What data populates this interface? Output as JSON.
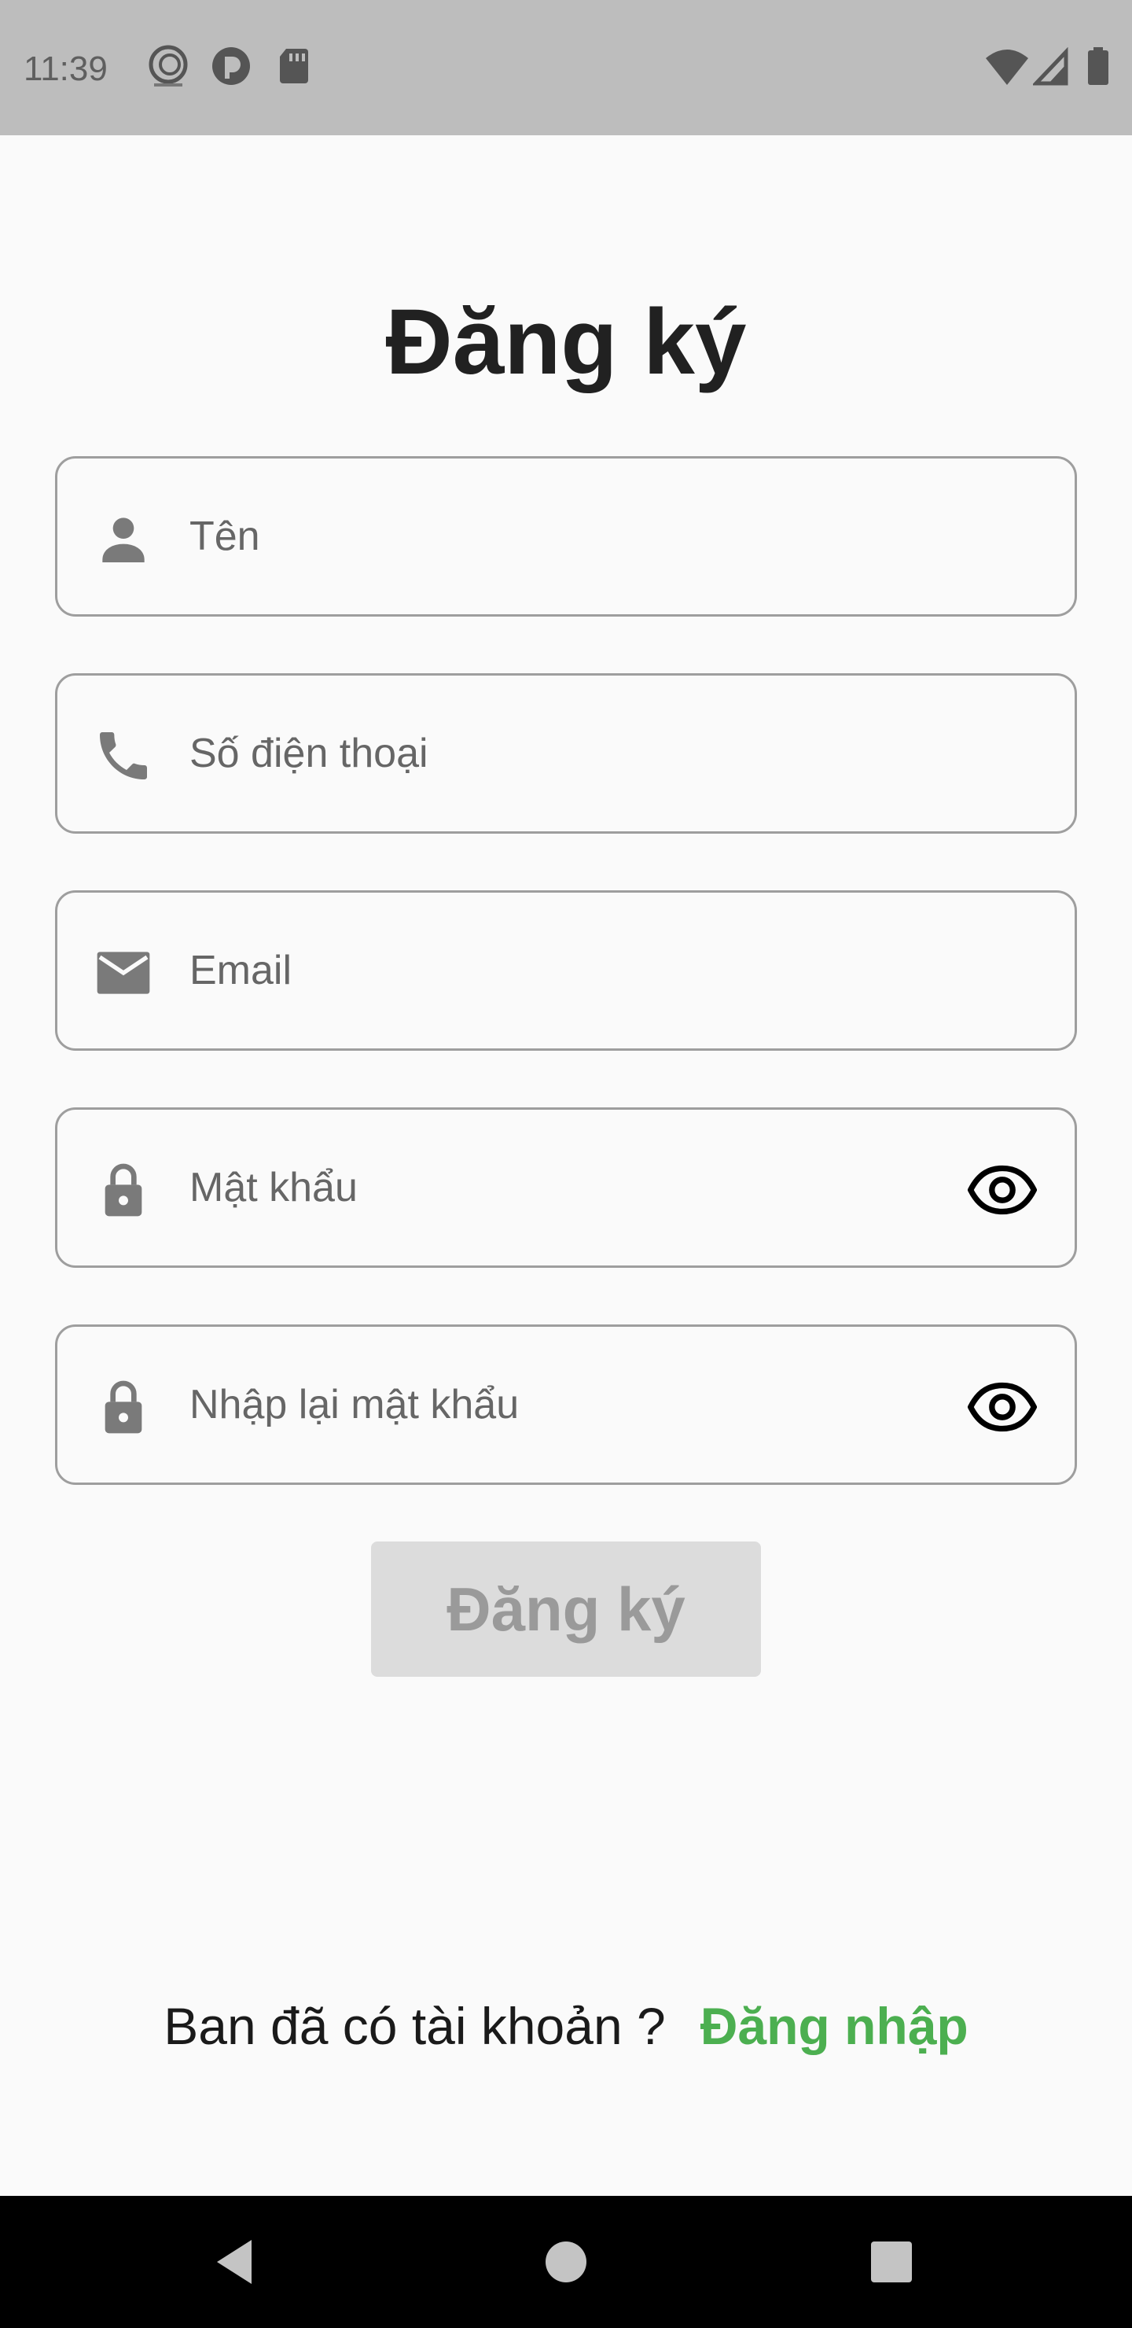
{
  "status_bar": {
    "time": "11:39",
    "left_icons": [
      "app-logo-icon",
      "pocket-icon",
      "sd-card-icon"
    ],
    "right_icons": [
      "wifi-icon",
      "signal-icon",
      "battery-icon"
    ]
  },
  "title": "Đăng ký",
  "fields": {
    "name": {
      "placeholder": "Tên",
      "value": "",
      "icon": "person-icon"
    },
    "phone": {
      "placeholder": "Số điện thoại",
      "value": "",
      "icon": "phone-icon"
    },
    "email": {
      "placeholder": "Email",
      "value": "",
      "icon": "mail-icon"
    },
    "password": {
      "placeholder": "Mật khẩu",
      "value": "",
      "icon": "lock-icon",
      "toggle_icon": "eye-icon"
    },
    "confirm_password": {
      "placeholder": "Nhập lại mật khẩu",
      "value": "",
      "icon": "lock-icon",
      "toggle_icon": "eye-icon"
    }
  },
  "submit_label": "Đăng ký",
  "login_prompt": {
    "question": "Ban đã có tài khoản ?",
    "link": "Đăng nhập"
  },
  "colors": {
    "accent_green": "#4caf50",
    "button_disabled_bg": "#dcdcdc",
    "button_disabled_text": "#9a9a9a",
    "field_border": "#9e9e9e",
    "icon_gray": "#7a7a7a"
  },
  "nav_bar": [
    "back-icon",
    "home-icon",
    "recents-icon"
  ]
}
